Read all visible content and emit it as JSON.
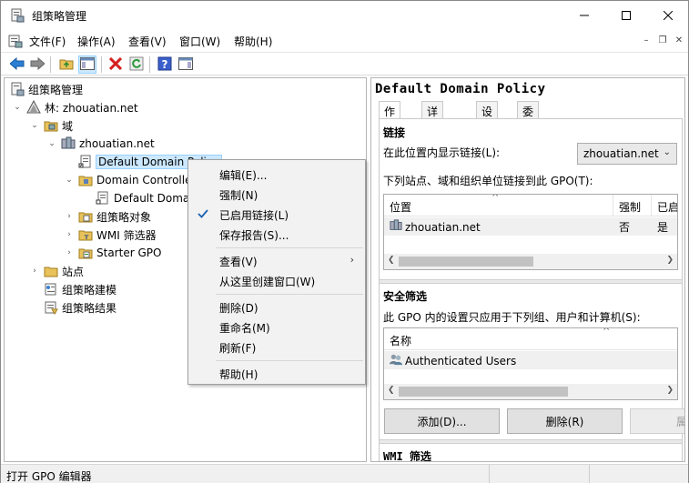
{
  "window": {
    "title": "组策略管理"
  },
  "menu": [
    "文件(F)",
    "操作(A)",
    "查看(V)",
    "窗口(W)",
    "帮助(H)"
  ],
  "tree": {
    "root": "组策略管理",
    "forest": "林: zhouatian.net",
    "domains": "域",
    "domain": "zhouatian.net",
    "default_policy": "Default Domain Policy",
    "dc_ou": "Domain Controllers",
    "dc_child": "Default Domain",
    "gpo_objects": "组策略对象",
    "wmi": "WMI 筛选器",
    "starter": "Starter GPO",
    "sites": "站点",
    "modeling": "组策略建模",
    "results": "组策略结果"
  },
  "context_menu": {
    "edit": "编辑(E)...",
    "enforce": "强制(N)",
    "link_enabled": "已启用链接(L)",
    "save_report": "保存报告(S)...",
    "view": "查看(V)",
    "new_window": "从这里创建窗口(W)",
    "delete": "删除(D)",
    "rename": "重命名(M)",
    "refresh": "刷新(F)",
    "help": "帮助(H)"
  },
  "right": {
    "title": "Default Domain Policy",
    "tabs": [
      "作用域",
      "详细信息",
      "设置",
      "委派"
    ],
    "links": {
      "heading": "链接",
      "show_label": "在此位置内显示链接(L):",
      "location_value": "zhouatian.net",
      "desc": "下列站点、域和组织单位链接到此 GPO(T):",
      "columns": [
        "位置",
        "强制",
        "已启"
      ],
      "rows": [
        {
          "location": "zhouatian.net",
          "enforced": "否",
          "enabled": "是"
        }
      ]
    },
    "security": {
      "heading": "安全筛选",
      "desc": "此 GPO 内的设置只应用于下列组、用户和计算机(S):",
      "column": "名称",
      "rows": [
        "Authenticated Users"
      ],
      "add_button": "添加(D)...",
      "remove_button": "删除(R)",
      "properties_button": "属"
    },
    "wmi_heading": "WMI 筛选"
  },
  "status": {
    "text": "打开 GPO 编辑器"
  }
}
